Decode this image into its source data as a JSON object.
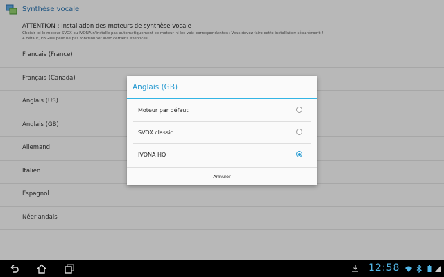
{
  "app": {
    "title": "Synthèse vocale"
  },
  "warning": {
    "title": "ATTENTION : Installation des moteurs de synthèse vocale",
    "lines": [
      "Choisir ici le moteur SVOX ou IVONA n'installe pas automatiquement ce moteur ni les voix correspondantes : Vous devez faire cette installation séparément !",
      "A défaut, EBGliss peut ne pas fonctionner avec certains exercices."
    ]
  },
  "languages": [
    "Français (France)",
    "Français (Canada)",
    "Anglais (US)",
    "Anglais (GB)",
    "Allemand",
    "Italien",
    "Espagnol",
    "Néerlandais"
  ],
  "dialog": {
    "title": "Anglais (GB)",
    "options": [
      {
        "label": "Moteur par défaut",
        "selected": false
      },
      {
        "label": "SVOX classic",
        "selected": false
      },
      {
        "label": "IVONA HQ",
        "selected": true
      }
    ],
    "cancel_label": "Annuler"
  },
  "status": {
    "time": "12:58"
  },
  "colors": {
    "accent": "#33b5e5",
    "title_blue": "#2a6fa8"
  }
}
